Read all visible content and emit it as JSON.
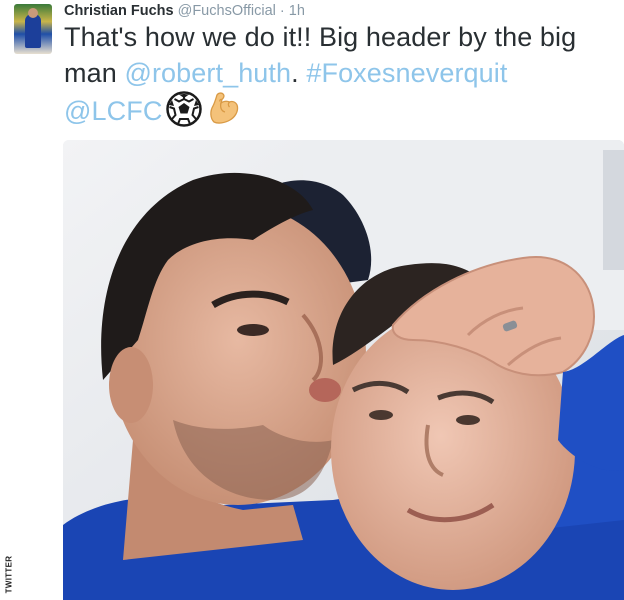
{
  "tweet": {
    "display_name": "Christian Fuchs",
    "handle": "@FuchsOfficial",
    "separator": "·",
    "time": "1h",
    "text_part1": "That's how we do it!! Big header by the big man ",
    "mention_huth": "@robert_huth",
    "text_part2": ". ",
    "hashtag": "#Foxesneverquit",
    "mention_club": "@LCFC",
    "emojis": [
      "soccer-ball-icon",
      "flexed-biceps-icon"
    ]
  },
  "credit": "TWITTER",
  "colors": {
    "text": "#292f33",
    "meta": "#8899a6",
    "link": "#8ec5ea",
    "kit_blue": "#1a45b4"
  }
}
